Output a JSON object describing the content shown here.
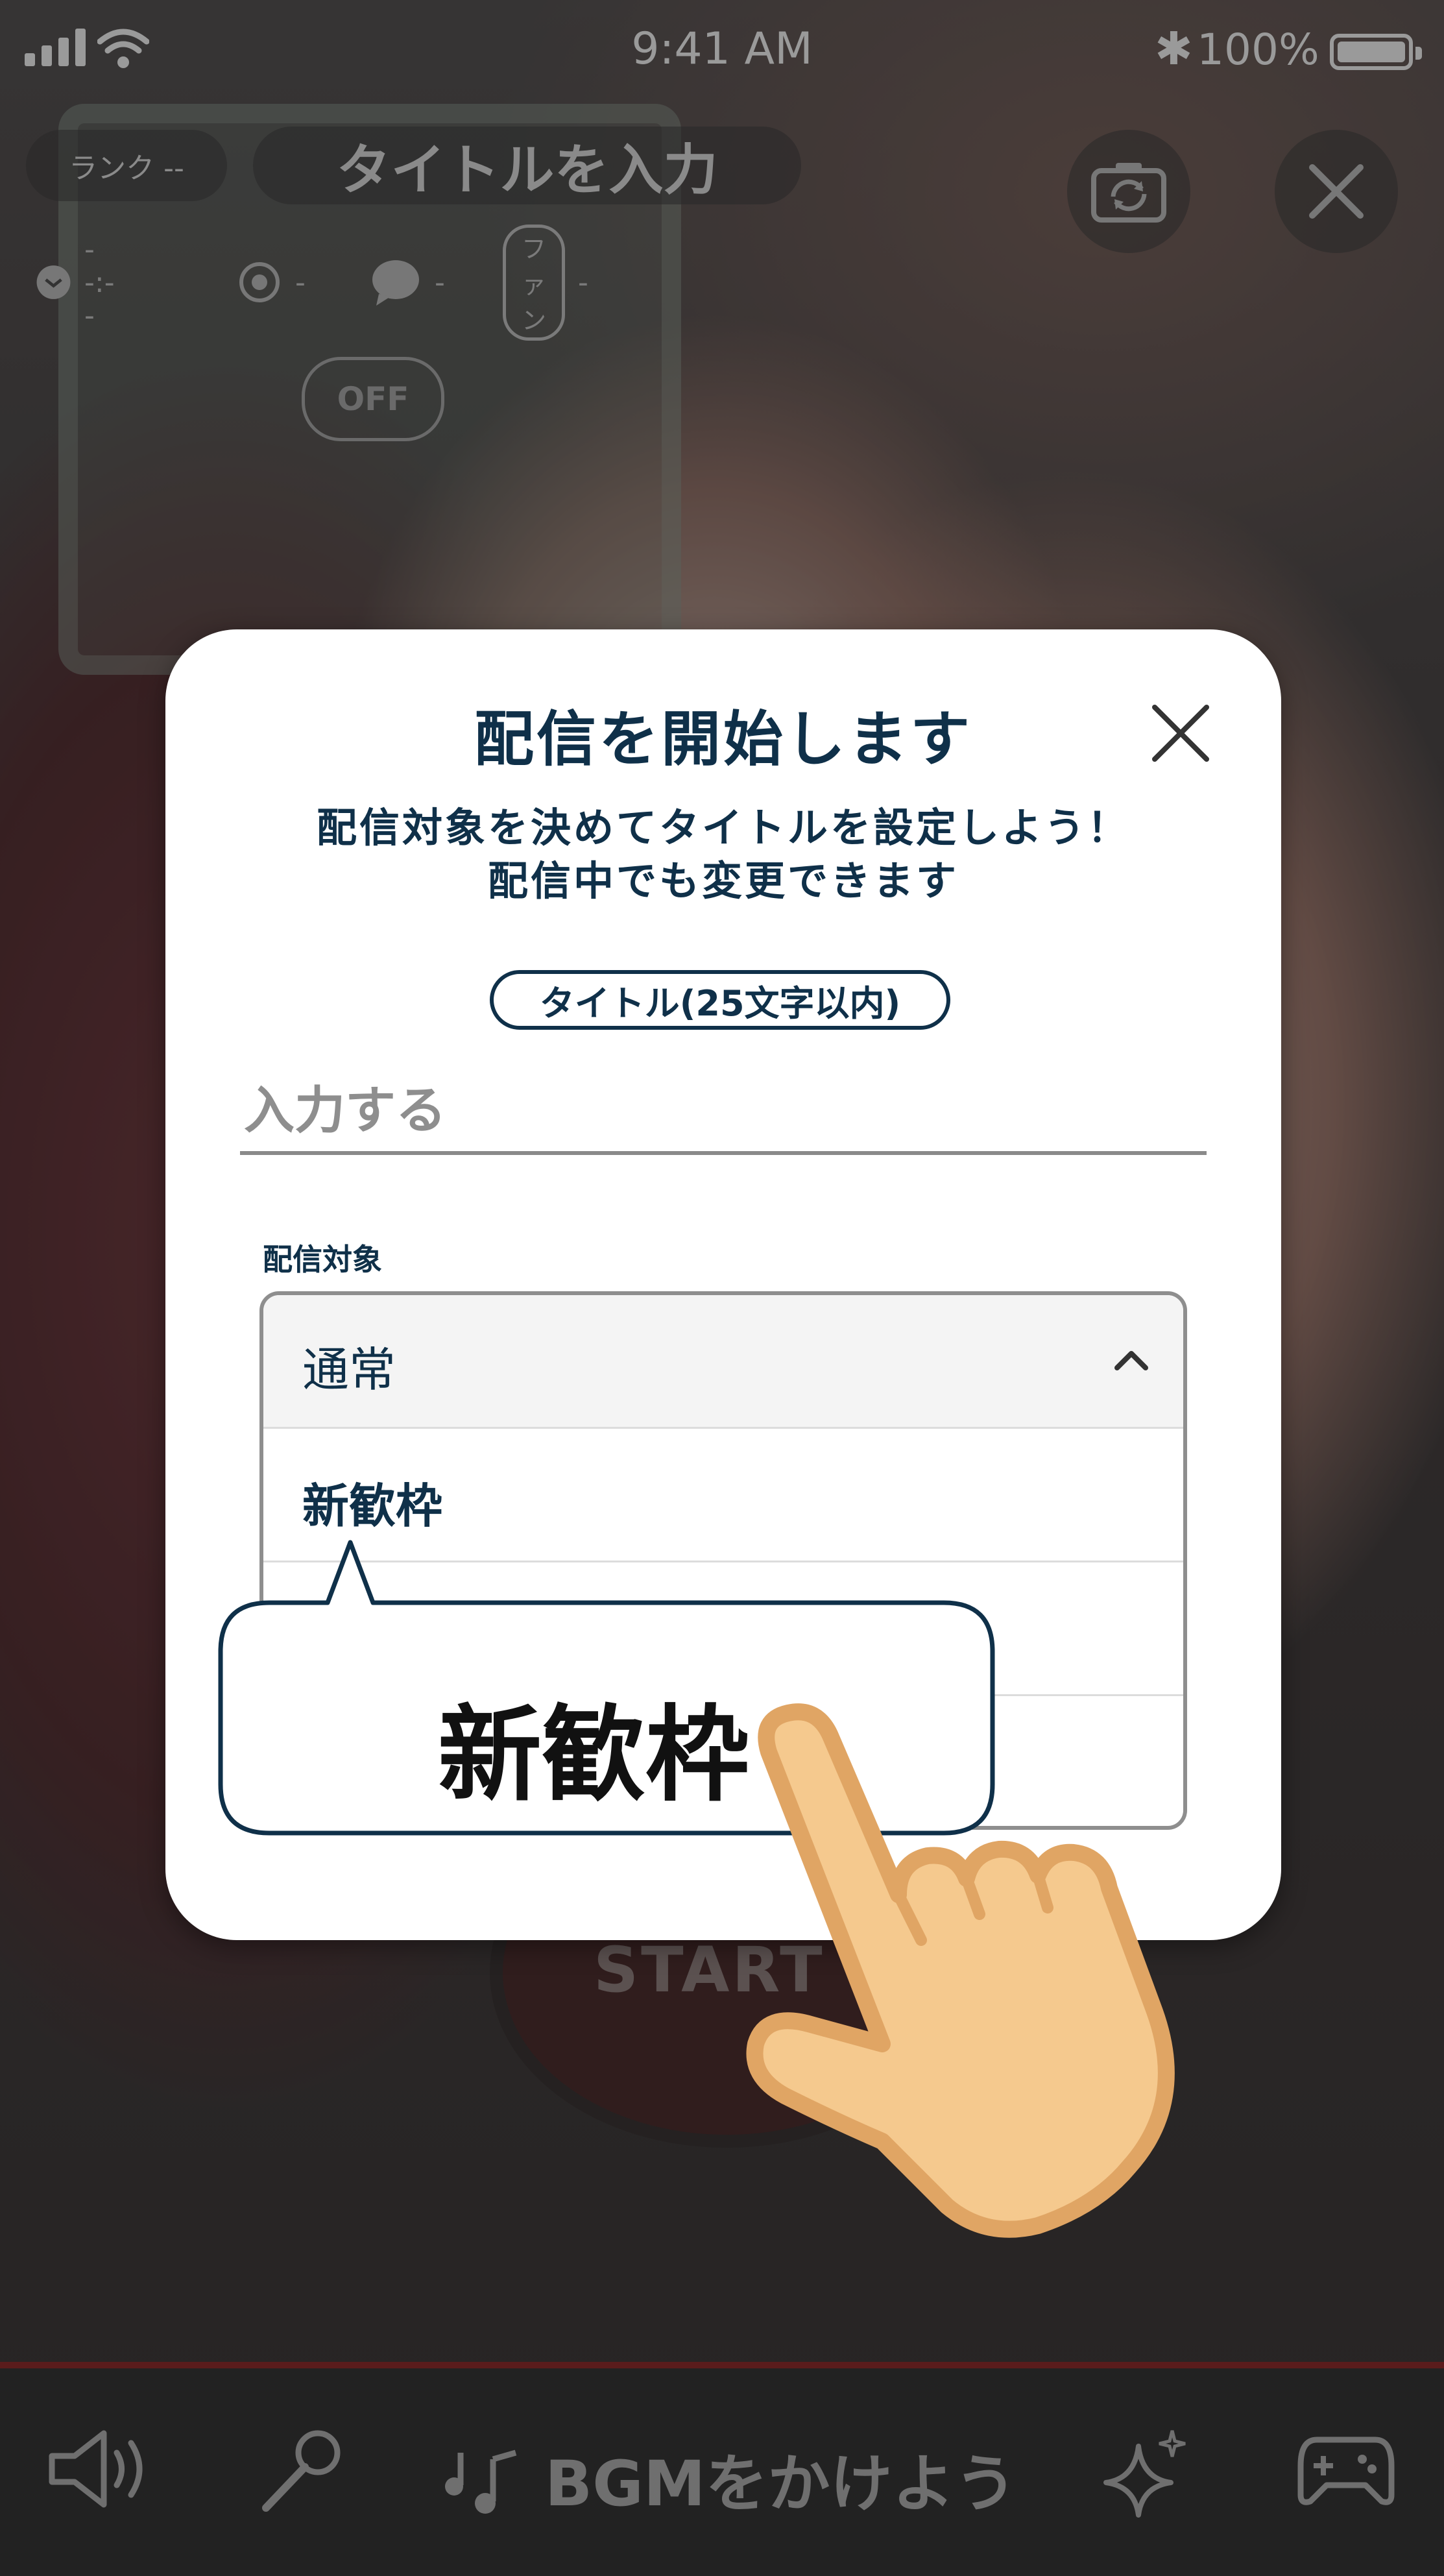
{
  "status_bar": {
    "time": "9:41 AM",
    "battery": "100%"
  },
  "top": {
    "rank": "ランク --",
    "title_placeholder": "タイトルを入力",
    "stats": {
      "time": "--:--",
      "views": "-",
      "comments": "-",
      "fan_label": "ファン",
      "fans": "-"
    },
    "comment_toggle": "OFF"
  },
  "background": {
    "start_label": "START"
  },
  "modal": {
    "title": "配信を開始します",
    "subtitle_line1": "配信対象を決めてタイトルを設定しよう！",
    "subtitle_line2": "配信中でも変更できます",
    "title_tag": "タイトル(25文字以内)",
    "input_placeholder": "入力する",
    "target_label": "配信対象",
    "select": {
      "selected": "通常",
      "options": [
        "新歓枠",
        "",
        ""
      ]
    }
  },
  "tutorial": {
    "callout": "新歓枠"
  },
  "toolbar": {
    "bgm_label": "BGMをかけよう"
  }
}
